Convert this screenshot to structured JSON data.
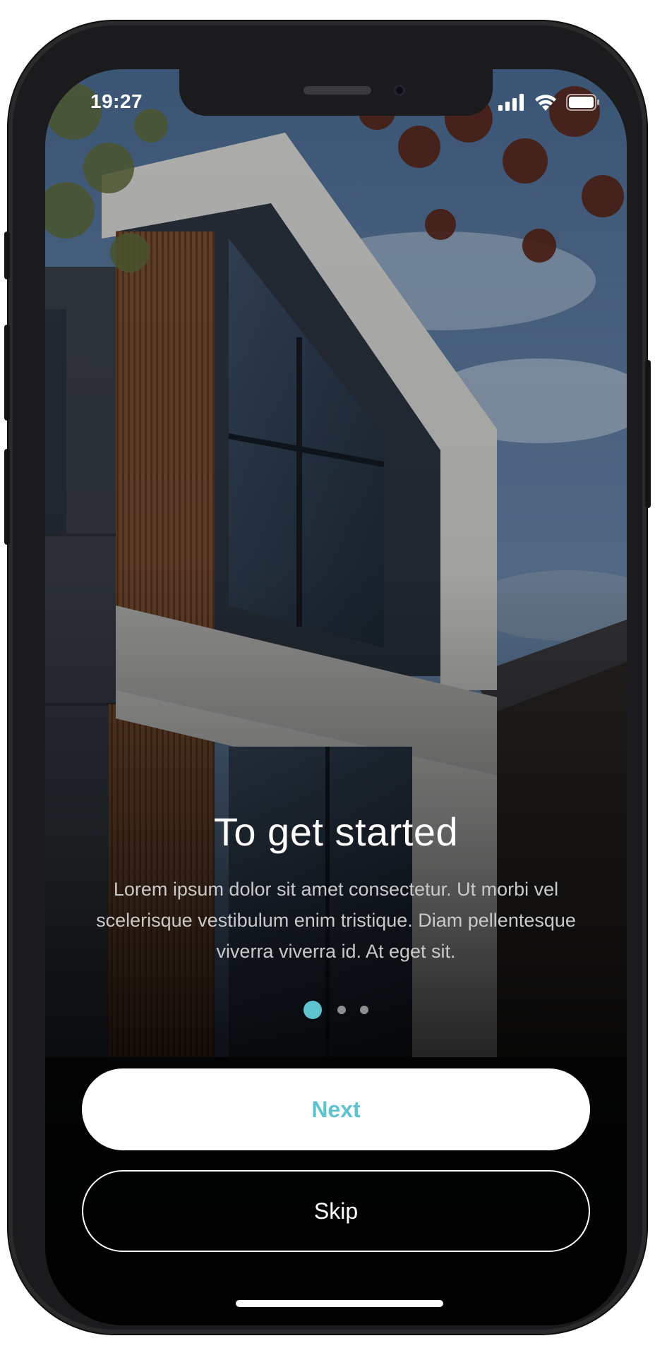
{
  "status_bar": {
    "time": "19:27",
    "icons": [
      "signal-icon",
      "wifi-icon",
      "battery-icon"
    ]
  },
  "onboarding": {
    "title": "To get started",
    "description": "Lorem ipsum dolor sit amet consectetur. Ut morbi vel scelerisque vestibulum enim tristique. Diam pellentesque viverra viverra id. At eget sit.",
    "page_indicator": {
      "total": 3,
      "current": 1
    }
  },
  "buttons": {
    "next_label": "Next",
    "skip_label": "Skip"
  },
  "colors": {
    "accent": "#5ec3cf",
    "button_bg": "#ffffff",
    "text_primary": "#ffffff",
    "text_secondary": "#c9c9c9"
  }
}
